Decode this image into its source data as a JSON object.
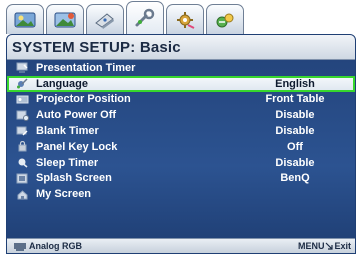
{
  "tabs": [
    {
      "icon": "picture-icon"
    },
    {
      "icon": "picture-advanced-icon"
    },
    {
      "icon": "display-icon"
    },
    {
      "icon": "system-setup-basic-icon",
      "active": true
    },
    {
      "icon": "system-setup-advanced-icon"
    },
    {
      "icon": "information-icon"
    }
  ],
  "menu": {
    "title": "SYSTEM SETUP: Basic",
    "items": [
      {
        "label": "Presentation Timer",
        "value": "",
        "icon": "timer-icon"
      },
      {
        "label": "Language",
        "value": "English",
        "icon": "language-icon",
        "selected": true
      },
      {
        "label": "Projector Position",
        "value": "Front Table",
        "icon": "projector-position-icon"
      },
      {
        "label": "Auto Power Off",
        "value": "Disable",
        "icon": "auto-power-off-icon"
      },
      {
        "label": "Blank Timer",
        "value": "Disable",
        "icon": "blank-timer-icon"
      },
      {
        "label": "Panel Key Lock",
        "value": "Off",
        "icon": "panel-key-lock-icon"
      },
      {
        "label": "Sleep Timer",
        "value": "Disable",
        "icon": "sleep-timer-icon"
      },
      {
        "label": "Splash Screen",
        "value": "BenQ",
        "icon": "splash-screen-icon"
      },
      {
        "label": "My Screen",
        "value": "",
        "icon": "my-screen-icon"
      }
    ]
  },
  "footer": {
    "source": "Analog RGB",
    "menu_key": "MENU",
    "exit_label": "Exit"
  },
  "colors": {
    "menu_bg": "#2c5391",
    "selection_outline": "#37d72d",
    "header_text": "#1c2b44"
  }
}
